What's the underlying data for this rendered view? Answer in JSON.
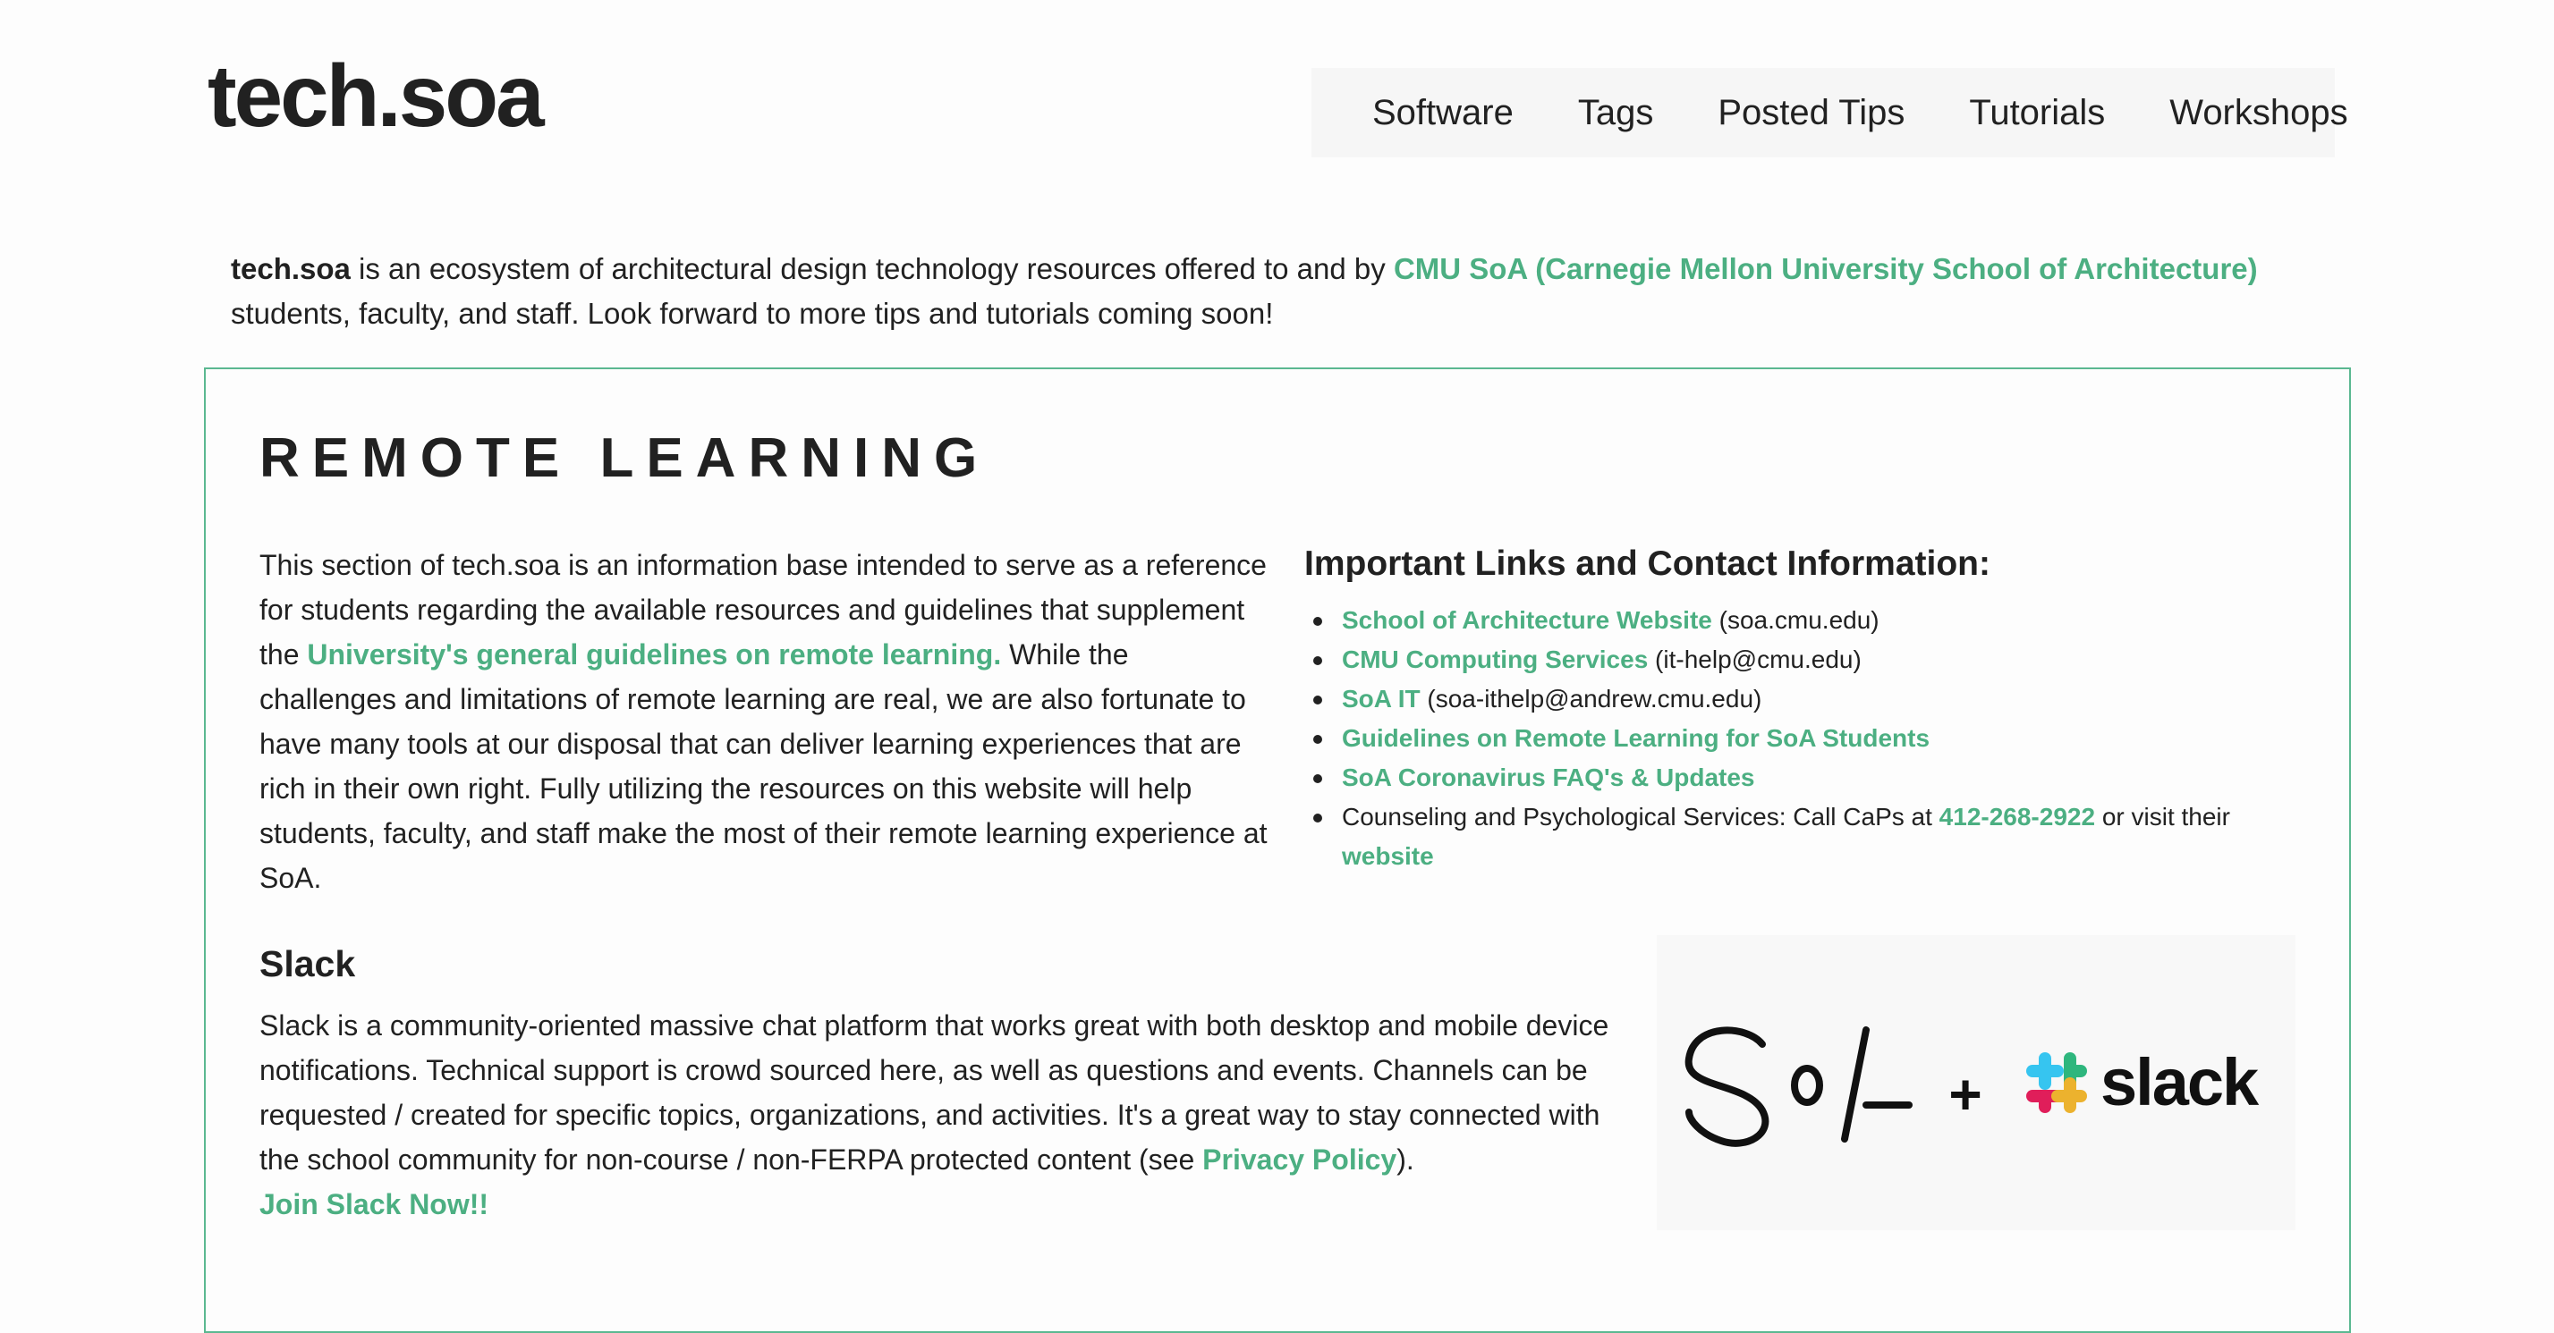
{
  "header": {
    "site_title": "tech.soa",
    "nav": [
      {
        "label": "Software"
      },
      {
        "label": "Tags"
      },
      {
        "label": "Posted Tips"
      },
      {
        "label": "Tutorials"
      },
      {
        "label": "Workshops"
      }
    ]
  },
  "intro": {
    "brand": "tech.soa",
    "text_before_link": " is an ecosystem of architectural design technology resources offered to and by ",
    "link": "CMU SoA (Carnegie Mellon University School of Architecture)",
    "text_after_link": " students, faculty, and staff. Look forward to more tips and tutorials coming soon!"
  },
  "remote_learning": {
    "heading": "REMOTE LEARNING",
    "para_before_link": "This section of tech.soa is an information base intended to serve as a reference for students regarding the available resources and guidelines that supplement the ",
    "para_link": "University's general guidelines on remote learning.",
    "para_after_link": " While the challenges and limitations of remote learning are real, we are also fortunate to have many tools at our disposal that can deliver learning experiences that are rich in their own right. Fully utilizing the resources on this website will help students, faculty, and staff make the most of their remote learning experience at SoA.",
    "links_heading": "Important Links and Contact Information:",
    "links": [
      {
        "link": "School of Architecture Website",
        "suffix": " (soa.cmu.edu)"
      },
      {
        "link": "CMU Computing Services",
        "suffix": " (it-help@cmu.edu)"
      },
      {
        "link": "SoA IT",
        "suffix": " (soa-ithelp@andrew.cmu.edu)"
      },
      {
        "link": "Guidelines on Remote Learning for SoA Students",
        "suffix": ""
      },
      {
        "link": "SoA Coronavirus FAQ's & Updates",
        "suffix": ""
      }
    ],
    "counseling": {
      "prefix": "Counseling and Psychological Services: Call CaPs at ",
      "phone": "412-268-2922",
      "middle": " or visit their ",
      "link": "website"
    }
  },
  "slack": {
    "heading": "Slack",
    "para_before_link": "Slack is a community-oriented massive chat platform that works great with both desktop and mobile device notifications. Technical support is crowd sourced here, as well as questions and events. Channels can be requested / created for specific topics, organizations, and activities. It's a great way to stay connected with the school community for non-course / non-FERPA protected content (see ",
    "privacy_link": "Privacy Policy",
    "para_after_link": ").",
    "join_link": "Join Slack Now!!",
    "banner": {
      "soa_logo": "SoA",
      "plus": "+",
      "slack_wordmark": "slack"
    }
  },
  "colors": {
    "link_green": "#4caf82",
    "box_border": "#5bb891",
    "text": "#212121",
    "slack_blue": "#36C5F0",
    "slack_green": "#2EB67D",
    "slack_red": "#E01E5A",
    "slack_yellow": "#ECB22E"
  },
  "icons": [
    "slack-hash-logo-icon",
    "soa-logo-icon"
  ]
}
